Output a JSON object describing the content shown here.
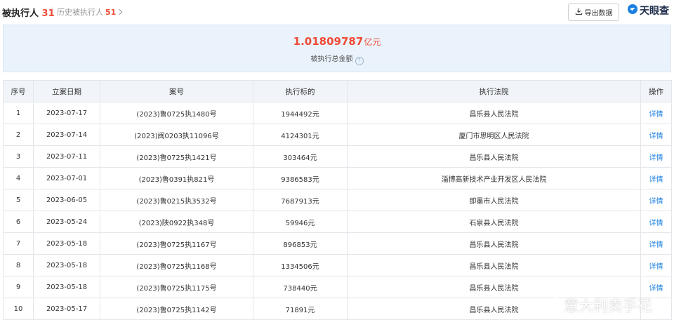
{
  "header": {
    "tab_main_label": "被执行人",
    "tab_main_count": "31",
    "tab_hist_label": "历史被执行人",
    "tab_hist_count": "51",
    "export_label": "导出数据",
    "logo_text": "天眼查"
  },
  "summary": {
    "amount": "1.01809787",
    "unit": "亿元",
    "label": "被执行总金额"
  },
  "table": {
    "columns": [
      "序号",
      "立案日期",
      "案号",
      "执行标的",
      "执行法院",
      "操作"
    ],
    "rows": [
      {
        "no": "1",
        "date": "2023-07-17",
        "case": "(2023)鲁0725执1480号",
        "amount": "1944492元",
        "court": "昌乐县人民法院",
        "op": "详情"
      },
      {
        "no": "2",
        "date": "2023-07-14",
        "case": "(2023)闽0203执11096号",
        "amount": "4124301元",
        "court": "厦门市思明区人民法院",
        "op": "详情"
      },
      {
        "no": "3",
        "date": "2023-07-11",
        "case": "(2023)鲁0725执1421号",
        "amount": "303464元",
        "court": "昌乐县人民法院",
        "op": "详情"
      },
      {
        "no": "4",
        "date": "2023-07-01",
        "case": "(2023)鲁0391执821号",
        "amount": "9386583元",
        "court": "淄博高新技术产业开发区人民法院",
        "op": "详情"
      },
      {
        "no": "5",
        "date": "2023-06-05",
        "case": "(2023)鲁0215执3532号",
        "amount": "7687913元",
        "court": "即墨市人民法院",
        "op": "详情"
      },
      {
        "no": "6",
        "date": "2023-05-24",
        "case": "(2023)陕0922执348号",
        "amount": "59946元",
        "court": "石泉县人民法院",
        "op": "详情"
      },
      {
        "no": "7",
        "date": "2023-05-18",
        "case": "(2023)鲁0725执1167号",
        "amount": "896853元",
        "court": "昌乐县人民法院",
        "op": "详情"
      },
      {
        "no": "8",
        "date": "2023-05-18",
        "case": "(2023)鲁0725执1168号",
        "amount": "1334506元",
        "court": "昌乐县人民法院",
        "op": "详情"
      },
      {
        "no": "9",
        "date": "2023-05-18",
        "case": "(2023)鲁0725执1175号",
        "amount": "738440元",
        "court": "昌乐县人民法院",
        "op": "详情"
      },
      {
        "no": "10",
        "date": "2023-05-17",
        "case": "(2023)鲁0725执1142号",
        "amount": "71891元",
        "court": "昌乐县人民法院",
        "op": ""
      }
    ]
  },
  "watermark": "意大利卖手花",
  "colors": {
    "accent_red": "#f04a35",
    "link_blue": "#1a7fe0",
    "summary_bg": "#eaf3fc"
  },
  "icons": {
    "export": "download-icon",
    "logo": "tianyancha-logo-icon",
    "help": "question-circle-icon"
  }
}
